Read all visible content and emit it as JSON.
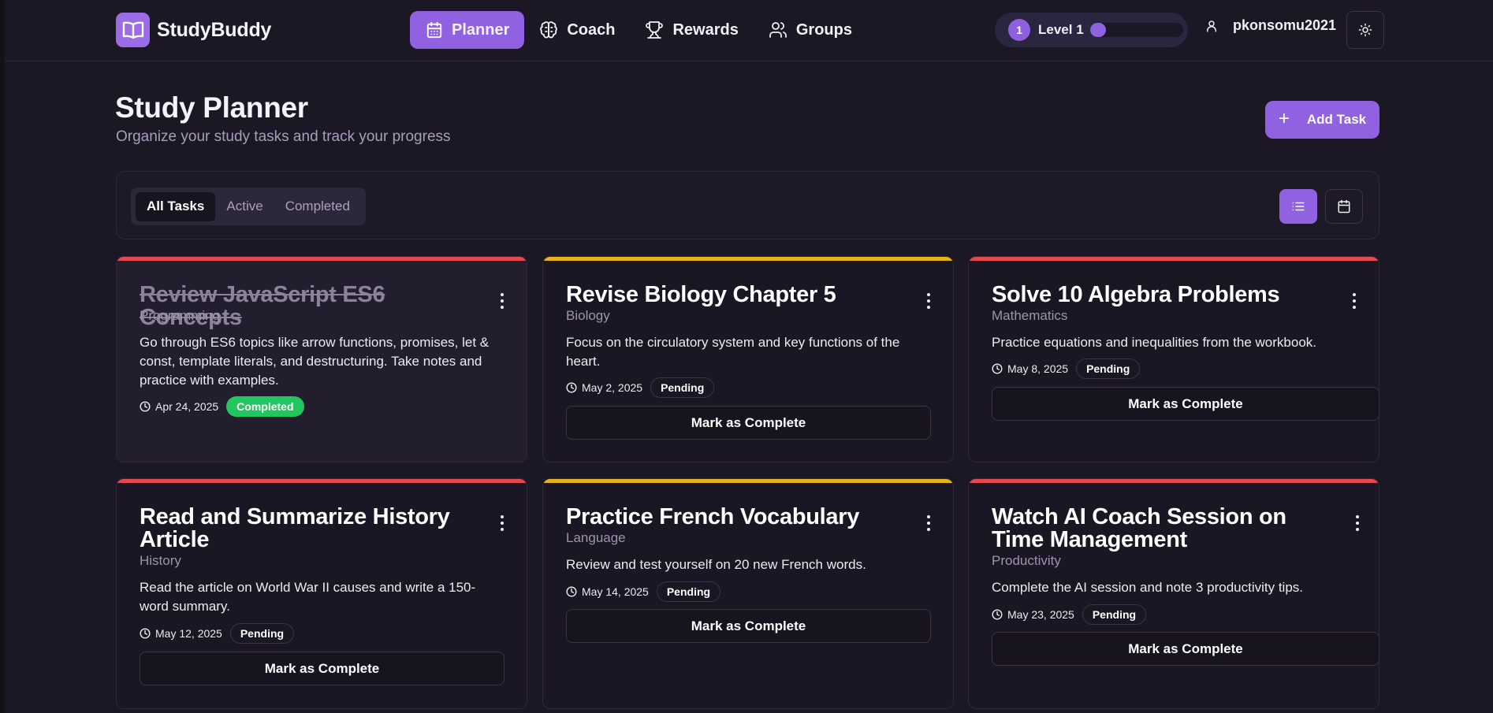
{
  "app": {
    "name": "StudyBuddy",
    "logo_icon": "book-open-icon"
  },
  "nav": {
    "items": [
      {
        "label": "Planner",
        "icon": "calendar-icon",
        "active": true
      },
      {
        "label": "Coach",
        "icon": "brain-icon",
        "active": false
      },
      {
        "label": "Rewards",
        "icon": "trophy-icon",
        "active": false
      },
      {
        "label": "Groups",
        "icon": "users-icon",
        "active": false
      }
    ]
  },
  "level": {
    "number": "1",
    "label": "Level 1",
    "progress": 0.1
  },
  "user": {
    "name": "pkonsomu2021",
    "icon": "user-icon"
  },
  "theme_toggle": {
    "icon": "sun-icon"
  },
  "page": {
    "title": "Study Planner",
    "subtitle": "Organize your study tasks and track your progress",
    "add_button": {
      "plus": "+",
      "label": "Add Task"
    }
  },
  "filters": {
    "tabs": [
      {
        "label": "All Tasks",
        "active": true
      },
      {
        "label": "Active",
        "active": false
      },
      {
        "label": "Completed",
        "active": false
      }
    ],
    "view_list_icon": "list-icon",
    "view_calendar_icon": "calendar-icon"
  },
  "colors": {
    "accent": "#9061e0",
    "high_priority": "#e5484d",
    "medium_priority": "#e8b21c",
    "completed": "#22c55e"
  },
  "tasks": [
    {
      "title": "Review JavaScript ES6 Concepts",
      "category": "Programming",
      "description": "Go through ES6 topics like arrow functions, promises, let & const, template literals, and destructuring. Take notes and practice with examples.",
      "date": "Apr 24, 2025",
      "status": "Completed",
      "priority_color": "#e5484d",
      "completed": true
    },
    {
      "title": "Revise Biology Chapter 5",
      "category": "Biology",
      "description": "Focus on the circulatory system and key functions of the heart.",
      "date": "May 2, 2025",
      "status": "Pending",
      "priority_color": "#e8b21c",
      "action": "Mark as Complete"
    },
    {
      "title": "Solve 10 Algebra Problems",
      "category": "Mathematics",
      "description": "Practice equations and inequalities from the workbook.",
      "date": "May 8, 2025",
      "status": "Pending",
      "priority_color": "#e5484d",
      "action": "Mark as Complete"
    },
    {
      "title": "Read and Summarize History Article",
      "category": "History",
      "description": "Read the article on World War II causes and write a 150-word summary.",
      "date": "May 12, 2025",
      "status": "Pending",
      "priority_color": "#e5484d",
      "action": "Mark as Complete"
    },
    {
      "title": "Practice French Vocabulary",
      "category": "Language",
      "description": "Review and test yourself on 20 new French words.",
      "date": "May 14, 2025",
      "status": "Pending",
      "priority_color": "#e8b21c",
      "action": "Mark as Complete"
    },
    {
      "title": "Watch AI Coach Session on Time Management",
      "category": "Productivity",
      "description": "Complete the AI session and note 3 productivity tips.",
      "date": "May 23, 2025",
      "status": "Pending",
      "priority_color": "#e5484d",
      "action": "Mark as Complete"
    }
  ]
}
